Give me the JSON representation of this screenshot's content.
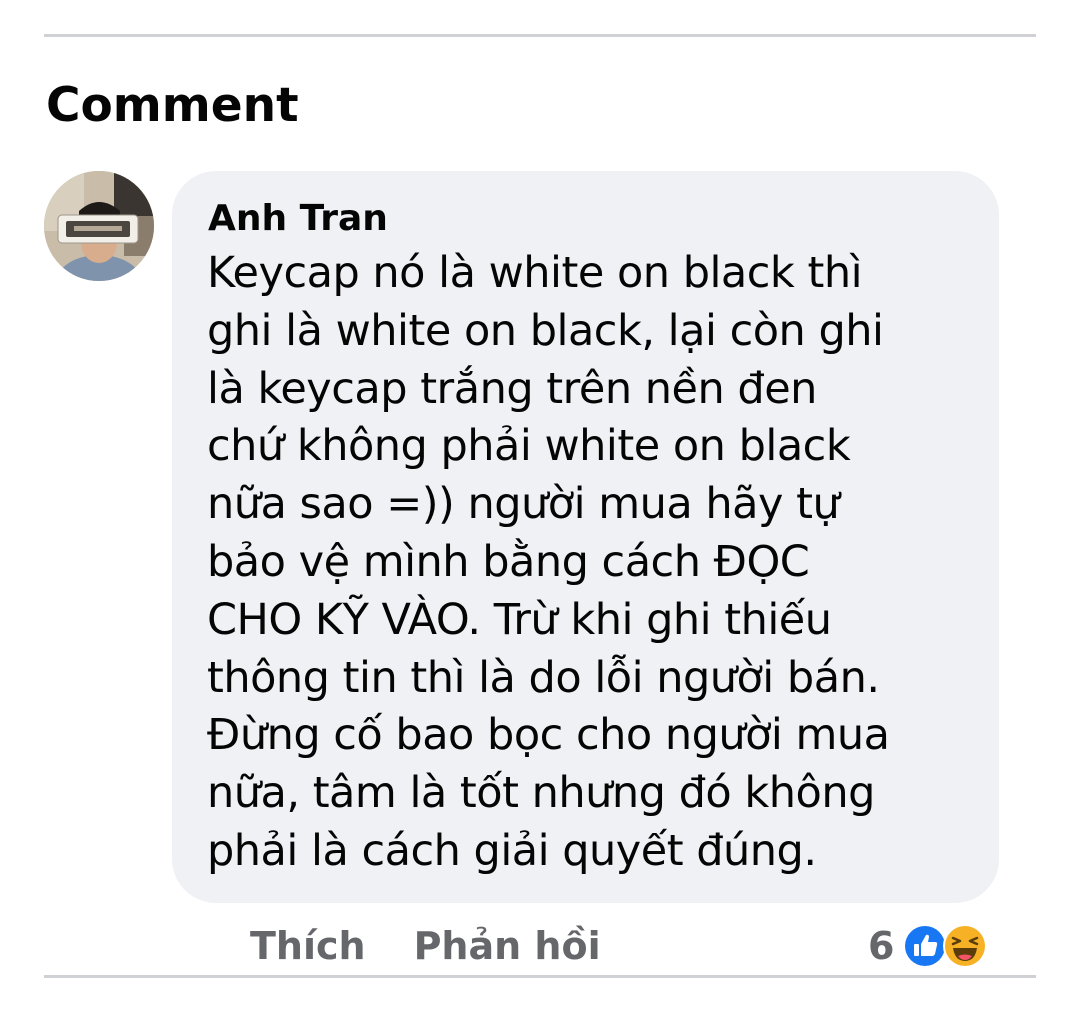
{
  "section": {
    "title": "Comment"
  },
  "comment": {
    "author": "Anh Tran",
    "lines": [
      "Keycap nó là white on black thì",
      "ghi là white on black, lại còn ghi",
      "là keycap trắng trên nền đen",
      "chứ không phải white on black",
      "nữa sao =)) người mua hãy tự",
      "bảo vệ mình bằng cách ĐỌC",
      "CHO KỸ VÀO. Trừ khi ghi thiếu",
      "thông tin thì là do lỗi người bán.",
      "Đừng cố bao bọc cho người mua",
      "nữa, tâm là tốt nhưng đó không",
      "phải là cách giải quyết đúng."
    ]
  },
  "actions": {
    "like_label": "Thích",
    "reply_label": "Phản hồi"
  },
  "reactions": {
    "count": "6",
    "icons": [
      "like-icon",
      "haha-icon"
    ]
  },
  "colors": {
    "bubble_bg": "#eff1f5",
    "action_text": "#65676b",
    "like_blue": "#1877f2",
    "haha_yellow": "#f7b125",
    "divider": "#cfd1d5"
  }
}
